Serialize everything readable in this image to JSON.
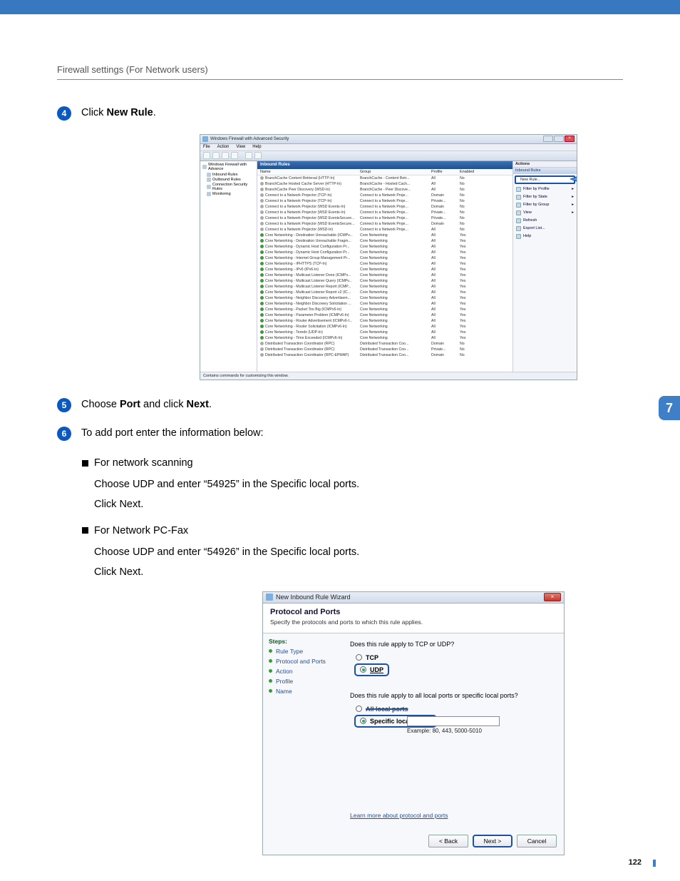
{
  "page": {
    "header": "Firewall settings (For Network users)",
    "sideTab": "7",
    "pageNumber": "122"
  },
  "steps": {
    "s4": {
      "num": "4",
      "before": "Click ",
      "bold": "New Rule",
      "after": "."
    },
    "s5": {
      "num": "5",
      "before1": "Choose ",
      "bold1": "Port",
      "mid": " and click ",
      "bold2": "Next",
      "after": "."
    },
    "s6": {
      "num": "6",
      "text": "To add port enter the information below:"
    }
  },
  "sub": {
    "net_scan_title": "For network scanning",
    "net_scan_line_a1": "Choose ",
    "net_scan_line_a_bold1": "UDP",
    "net_scan_line_a2": " and enter “",
    "net_scan_line_a_bold2": "54925",
    "net_scan_line_a3": "” in the ",
    "net_scan_line_a_bold3": "Specific local ports",
    "net_scan_line_a4": ".",
    "click_next_a": "Click ",
    "click_next_b": "Next",
    "click_next_c": ".",
    "pcfax_title": "For Network PC-Fax",
    "pcfax_line_a1": "Choose ",
    "pcfax_line_a_bold1": "UDP",
    "pcfax_line_a2": " and enter “",
    "pcfax_line_a_bold2": "54926",
    "pcfax_line_a3": "” in the ",
    "pcfax_line_a_bold3": "Specific local ports",
    "pcfax_line_a4": "."
  },
  "shot1": {
    "title": "Windows Firewall with Advanced Security",
    "menus": [
      "File",
      "Action",
      "View",
      "Help"
    ],
    "leftRoot": "Windows Firewall with Advance",
    "leftNodes": [
      "Inbound Rules",
      "Outbound Rules",
      "Connection Security Rules",
      "Monitoring"
    ],
    "midTitle": "Inbound Rules",
    "cols": [
      "Name",
      "Group",
      "Profile",
      "Enabled"
    ],
    "rows": [
      {
        "on": false,
        "name": "BranchCache Content Retrieval (HTTP-In)",
        "group": "BranchCache - Content Retr...",
        "profile": "All",
        "enabled": "No"
      },
      {
        "on": false,
        "name": "BranchCache Hosted Cache Server (HTTP-In)",
        "group": "BranchCache - Hosted Cach...",
        "profile": "All",
        "enabled": "No"
      },
      {
        "on": false,
        "name": "BranchCache Peer Discovery (WSD-In)",
        "group": "BranchCache - Peer Discove...",
        "profile": "All",
        "enabled": "No"
      },
      {
        "on": false,
        "name": "Connect to a Network Projector (TCP-In)",
        "group": "Connect to a Network Proje...",
        "profile": "Domain",
        "enabled": "No"
      },
      {
        "on": false,
        "name": "Connect to a Network Projector (TCP-In)",
        "group": "Connect to a Network Proje...",
        "profile": "Private...",
        "enabled": "No"
      },
      {
        "on": false,
        "name": "Connect to a Network Projector (WSD Events-In)",
        "group": "Connect to a Network Proje...",
        "profile": "Domain",
        "enabled": "No"
      },
      {
        "on": false,
        "name": "Connect to a Network Projector (WSD Events-In)",
        "group": "Connect to a Network Proje...",
        "profile": "Private...",
        "enabled": "No"
      },
      {
        "on": false,
        "name": "Connect to a Network Projector (WSD EventsSecure...",
        "group": "Connect to a Network Proje...",
        "profile": "Private...",
        "enabled": "No"
      },
      {
        "on": false,
        "name": "Connect to a Network Projector (WSD EventsSecure...",
        "group": "Connect to a Network Proje...",
        "profile": "Domain",
        "enabled": "No"
      },
      {
        "on": false,
        "name": "Connect to a Network Projector (WSD-In)",
        "group": "Connect to a Network Proje...",
        "profile": "All",
        "enabled": "No"
      },
      {
        "on": true,
        "name": "Core Networking - Destination Unreachable (ICMPv...",
        "group": "Core Networking",
        "profile": "All",
        "enabled": "Yes"
      },
      {
        "on": true,
        "name": "Core Networking - Destination Unreachable Fragm...",
        "group": "Core Networking",
        "profile": "All",
        "enabled": "Yes"
      },
      {
        "on": true,
        "name": "Core Networking - Dynamic Host Configuration Pr...",
        "group": "Core Networking",
        "profile": "All",
        "enabled": "Yes"
      },
      {
        "on": true,
        "name": "Core Networking - Dynamic Host Configuration Pr...",
        "group": "Core Networking",
        "profile": "All",
        "enabled": "Yes"
      },
      {
        "on": true,
        "name": "Core Networking - Internet Group Management Pr...",
        "group": "Core Networking",
        "profile": "All",
        "enabled": "Yes"
      },
      {
        "on": true,
        "name": "Core Networking - IPHTTPS (TCP-In)",
        "group": "Core Networking",
        "profile": "All",
        "enabled": "Yes"
      },
      {
        "on": true,
        "name": "Core Networking - IPv6 (IPv6-In)",
        "group": "Core Networking",
        "profile": "All",
        "enabled": "Yes"
      },
      {
        "on": true,
        "name": "Core Networking - Multicast Listener Done (ICMPv...",
        "group": "Core Networking",
        "profile": "All",
        "enabled": "Yes"
      },
      {
        "on": true,
        "name": "Core Networking - Multicast Listener Query (ICMPv...",
        "group": "Core Networking",
        "profile": "All",
        "enabled": "Yes"
      },
      {
        "on": true,
        "name": "Core Networking - Multicast Listener Report (ICMP...",
        "group": "Core Networking",
        "profile": "All",
        "enabled": "Yes"
      },
      {
        "on": true,
        "name": "Core Networking - Multicast Listener Report v2 (IC...",
        "group": "Core Networking",
        "profile": "All",
        "enabled": "Yes"
      },
      {
        "on": true,
        "name": "Core Networking - Neighbor Discovery Advertisem...",
        "group": "Core Networking",
        "profile": "All",
        "enabled": "Yes"
      },
      {
        "on": true,
        "name": "Core Networking - Neighbor Discovery Solicitation ...",
        "group": "Core Networking",
        "profile": "All",
        "enabled": "Yes"
      },
      {
        "on": true,
        "name": "Core Networking - Packet Too Big (ICMPv6-In)",
        "group": "Core Networking",
        "profile": "All",
        "enabled": "Yes"
      },
      {
        "on": true,
        "name": "Core Networking - Parameter Problem (ICMPv6-In)",
        "group": "Core Networking",
        "profile": "All",
        "enabled": "Yes"
      },
      {
        "on": true,
        "name": "Core Networking - Router Advertisement (ICMPv6-I...",
        "group": "Core Networking",
        "profile": "All",
        "enabled": "Yes"
      },
      {
        "on": true,
        "name": "Core Networking - Router Solicitation (ICMPv6-In)",
        "group": "Core Networking",
        "profile": "All",
        "enabled": "Yes"
      },
      {
        "on": true,
        "name": "Core Networking - Teredo (UDP-In)",
        "group": "Core Networking",
        "profile": "All",
        "enabled": "Yes"
      },
      {
        "on": true,
        "name": "Core Networking - Time Exceeded (ICMPv6-In)",
        "group": "Core Networking",
        "profile": "All",
        "enabled": "Yes"
      },
      {
        "on": false,
        "name": "Distributed Transaction Coordinator (RPC)",
        "group": "Distributed Transaction Coo...",
        "profile": "Domain",
        "enabled": "No"
      },
      {
        "on": false,
        "name": "Distributed Transaction Coordinator (RPC)",
        "group": "Distributed Transaction Coo...",
        "profile": "Private...",
        "enabled": "No"
      },
      {
        "on": false,
        "name": "Distributed Transaction Coordinator (RPC-EPMAP)",
        "group": "Distributed Transaction Coo...",
        "profile": "Domain",
        "enabled": "No"
      }
    ],
    "actions": {
      "header": "Actions",
      "groupTitle": "Inbound Rules",
      "newRule": "New Rule...",
      "items": [
        "Filter by Profile",
        "Filter by State",
        "Filter by Group",
        "View",
        "Refresh",
        "Export List...",
        "Help"
      ]
    },
    "status": "Contains commands for customizing this window."
  },
  "shot2": {
    "title": "New Inbound Rule Wizard",
    "headTitle": "Protocol and Ports",
    "headSub": "Specify the protocols and ports to which this rule applies.",
    "stepsLabel": "Steps:",
    "steps": [
      "Rule Type",
      "Protocol and Ports",
      "Action",
      "Profile",
      "Name"
    ],
    "q1": "Does this rule apply to TCP or UDP?",
    "tcp": "TCP",
    "udp": "UDP",
    "q2": "Does this rule apply to all local ports or specific local ports?",
    "allPorts": "All local ports",
    "specificPorts": "Specific local ports:",
    "example": "Example: 80, 443, 5000-5010",
    "learn": "Learn more about protocol and ports",
    "back": "< Back",
    "next": "Next >",
    "cancel": "Cancel"
  }
}
